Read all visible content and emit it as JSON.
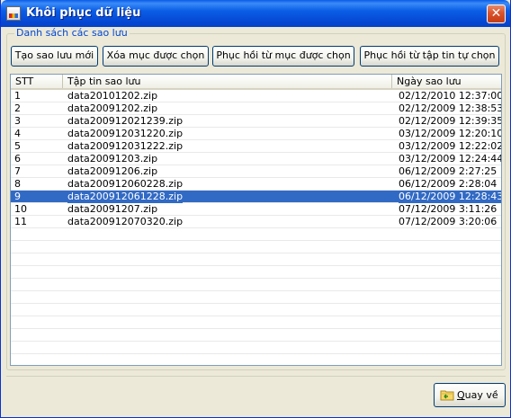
{
  "window": {
    "title": "Khôi phục dữ liệu",
    "close_symbol": "✕"
  },
  "group": {
    "legend": "Danh sách các sao lưu"
  },
  "toolbar": {
    "create_label": "Tạo sao lưu mới",
    "delete_label": "Xóa mục được chọn",
    "restore_selected_label": "Phục hồi từ mục được chọn",
    "restore_file_label": "Phục hồi từ tập tin tự chọn"
  },
  "list": {
    "columns": [
      "STT",
      "Tập tin sao lưu",
      "Ngày sao lưu"
    ],
    "rows": [
      {
        "stt": "1",
        "file": "data20101202.zip",
        "date": "02/12/2010 12:37:00"
      },
      {
        "stt": "2",
        "file": "data20091202.zip",
        "date": "02/12/2009 12:38:53"
      },
      {
        "stt": "3",
        "file": "data200912021239.zip",
        "date": "02/12/2009 12:39:35"
      },
      {
        "stt": "4",
        "file": "data200912031220.zip",
        "date": "03/12/2009 12:20:10"
      },
      {
        "stt": "5",
        "file": "data200912031222.zip",
        "date": "03/12/2009 12:22:02"
      },
      {
        "stt": "6",
        "file": "data20091203.zip",
        "date": "03/12/2009 12:24:44"
      },
      {
        "stt": "7",
        "file": "data20091206.zip",
        "date": "06/12/2009 2:27:25"
      },
      {
        "stt": "8",
        "file": "data200912060228.zip",
        "date": "06/12/2009 2:28:04"
      },
      {
        "stt": "9",
        "file": "data200912061228.zip",
        "date": "06/12/2009 12:28:43"
      },
      {
        "stt": "10",
        "file": "data20091207.zip",
        "date": "07/12/2009 3:11:26"
      },
      {
        "stt": "11",
        "file": "data200912070320.zip",
        "date": "07/12/2009 3:20:06"
      }
    ],
    "selected_index": 8,
    "empty_row_count": 10
  },
  "footer": {
    "back_label_accel": "Q",
    "back_label_rest": "uay về",
    "back_icon": "folder-back-icon"
  },
  "colors": {
    "selection": "#316ac5",
    "title_bar": "#0548d3",
    "legend_text": "#0046d5"
  }
}
